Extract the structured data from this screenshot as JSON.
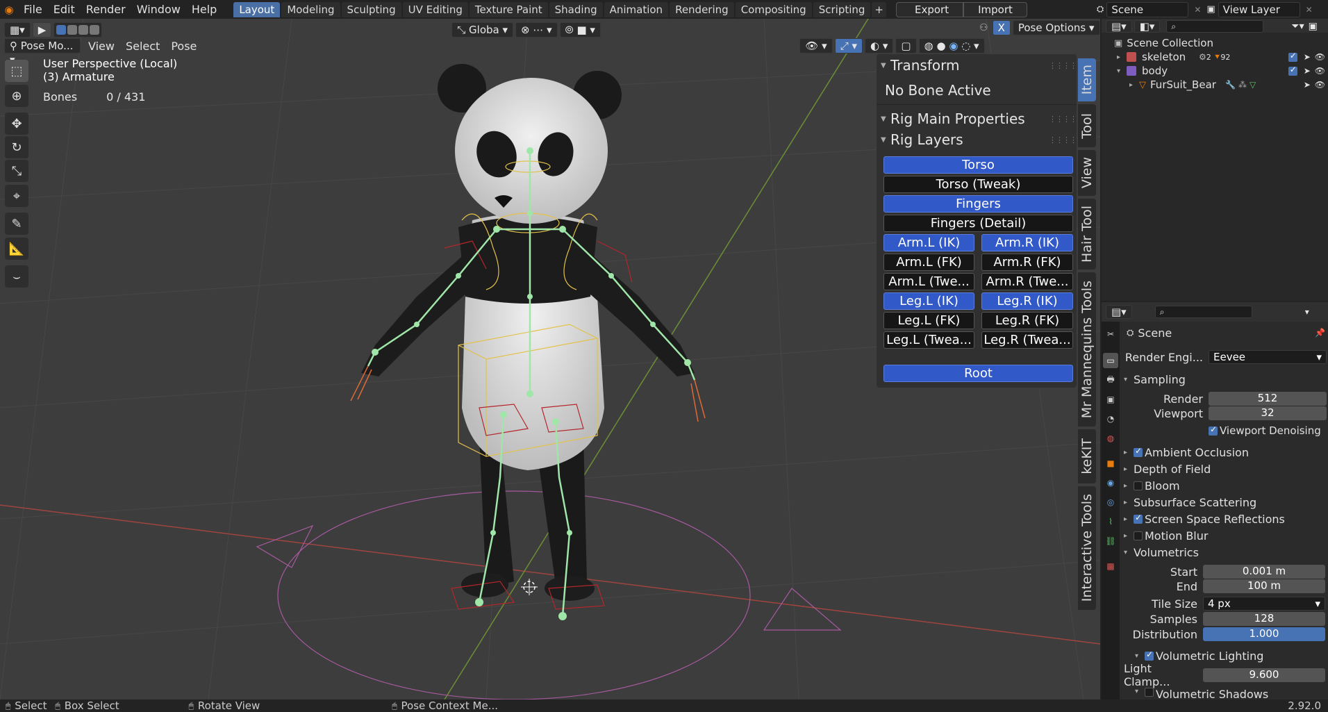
{
  "menu": [
    "File",
    "Edit",
    "Render",
    "Window",
    "Help"
  ],
  "workspaces": [
    "Layout",
    "Modeling",
    "Sculpting",
    "UV Editing",
    "Texture Paint",
    "Shading",
    "Animation",
    "Rendering",
    "Compositing",
    "Scripting"
  ],
  "topbar": {
    "plus": "+",
    "export": "Export",
    "import": "Import",
    "scene": "Scene",
    "view_layer": "View Layer"
  },
  "viewport_header": {
    "mode": "Pose Mo...",
    "menus": [
      "View",
      "Select",
      "Pose"
    ],
    "orientation": "Globa",
    "pose_options": "Pose Options",
    "x_toggle": "X"
  },
  "overlay": {
    "line1": "User Perspective (Local)",
    "line2": "(3) Armature",
    "bones_label": "Bones",
    "bones_value": "0 / 431"
  },
  "npanel": {
    "transform": "Transform",
    "no_bone": "No Bone Active",
    "rig_main": "Rig Main Properties",
    "rig_layers": "Rig Layers",
    "buttons": {
      "torso": "Torso",
      "torso_tweak": "Torso (Tweak)",
      "fingers": "Fingers",
      "fingers_detail": "Fingers (Detail)",
      "arm_l_ik": "Arm.L (IK)",
      "arm_r_ik": "Arm.R (IK)",
      "arm_l_fk": "Arm.L (FK)",
      "arm_r_fk": "Arm.R (FK)",
      "arm_l_tw": "Arm.L (Twe...",
      "arm_r_tw": "Arm.R (Twe...",
      "leg_l_ik": "Leg.L (IK)",
      "leg_r_ik": "Leg.R (IK)",
      "leg_l_fk": "Leg.L (FK)",
      "leg_r_fk": "Leg.R (FK)",
      "leg_l_tw": "Leg.L (Twea...",
      "leg_r_tw": "Leg.R (Twea...",
      "root": "Root"
    }
  },
  "side_tabs": [
    "Item",
    "Tool",
    "View",
    "Hair Tool",
    "Mr Mannequins Tools",
    "keKIT",
    "Interactive Tools"
  ],
  "outliner": {
    "collection": "Scene Collection",
    "skeleton": "skeleton",
    "skeleton_badge1": "2",
    "skeleton_badge2": "92",
    "body": "body",
    "fursuit": "FurSuit_Bear"
  },
  "properties": {
    "scene": "Scene",
    "render_engine_label": "Render Engi...",
    "render_engine": "Eevee",
    "sampling": "Sampling",
    "render_label": "Render",
    "render_value": "512",
    "viewport_label": "Viewport",
    "viewport_value": "32",
    "viewport_denoising": "Viewport Denoising",
    "ambient_occlusion": "Ambient Occlusion",
    "depth_of_field": "Depth of Field",
    "bloom": "Bloom",
    "subsurface": "Subsurface Scattering",
    "ssr": "Screen Space Reflections",
    "motion_blur": "Motion Blur",
    "volumetrics": "Volumetrics",
    "start_label": "Start",
    "start_value": "0.001 m",
    "end_label": "End",
    "end_value": "100 m",
    "tile_label": "Tile Size",
    "tile_value": "4 px",
    "samples_label": "Samples",
    "samples_value": "128",
    "dist_label": "Distribution",
    "dist_value": "1.000",
    "vol_lighting": "Volumetric Lighting",
    "light_clamp_label": "Light Clamp...",
    "light_clamp_value": "9.600",
    "vol_shadows": "Volumetric Shadows"
  },
  "status": {
    "select": "Select",
    "box_select": "Box Select",
    "rotate": "Rotate View",
    "context": "Pose Context Me...",
    "version": "2.92.0"
  },
  "colors": {
    "accent": "#4772b3",
    "rig_on": "#3259c8",
    "bone": "#9fe6a8",
    "axis_x": "#c0504d",
    "axis_y": "#7ba23f"
  }
}
